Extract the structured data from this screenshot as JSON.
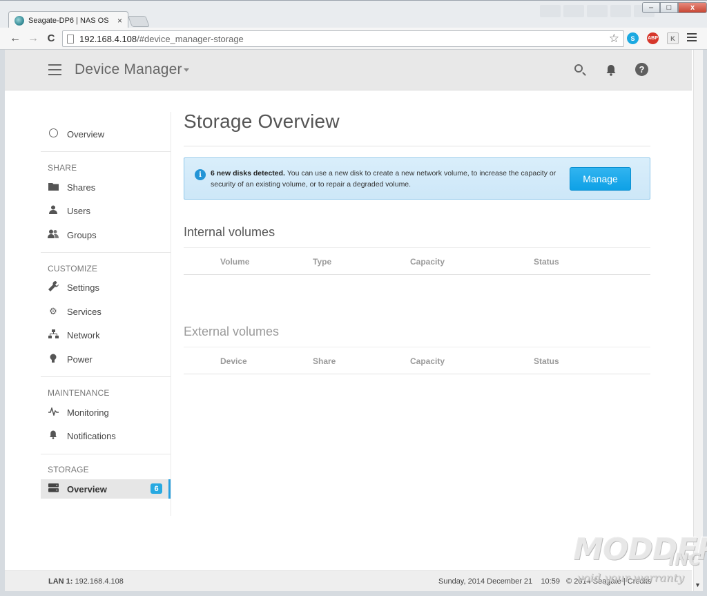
{
  "browser": {
    "tab_title": "Seagate-DP6 | NAS OS",
    "tab_close": "×",
    "url_host": "192.168.4.108",
    "url_path": "/#device_manager-storage",
    "back": "←",
    "forward": "→",
    "reload": "C",
    "star": "☆",
    "ext_skype": "S",
    "ext_abp": "ABP",
    "ext_k": "K",
    "win_min": "–",
    "win_max": "□",
    "win_close": "x"
  },
  "header": {
    "title": "Device Manager",
    "bell": "🔔",
    "help": "?"
  },
  "sidebar": {
    "overview_top": "Overview",
    "sections": {
      "share": "SHARE",
      "customize": "CUSTOMIZE",
      "maintenance": "MAINTENANCE",
      "storage": "STORAGE"
    },
    "items": {
      "shares": "Shares",
      "users": "Users",
      "groups": "Groups",
      "settings": "Settings",
      "services": "Services",
      "network": "Network",
      "power": "Power",
      "monitoring": "Monitoring",
      "notifications": "Notifications",
      "storage_overview": "Overview"
    },
    "storage_badge": "6"
  },
  "main": {
    "page_title": "Storage Overview",
    "alert": {
      "icon": "i",
      "bold": "6 new disks detected.",
      "text": " You can use a new disk to create a new network volume, to increase the capacity or security of an existing volume, or to repair a degraded volume.",
      "button": "Manage"
    },
    "internal": {
      "heading": "Internal volumes",
      "columns": [
        "Volume",
        "Type",
        "Capacity",
        "Status"
      ]
    },
    "external": {
      "heading": "External volumes",
      "columns": [
        "Device",
        "Share",
        "Capacity",
        "Status"
      ]
    }
  },
  "footer": {
    "lan_label": "LAN 1:",
    "lan_ip": " 192.168.4.108",
    "date": "Sunday, 2014 December 21",
    "time": "10:59",
    "copyright": "© 2014 Seagate | Credits"
  },
  "watermark": {
    "main": "MODDERS",
    "inc": "INC",
    "sub": "void your warranty"
  }
}
